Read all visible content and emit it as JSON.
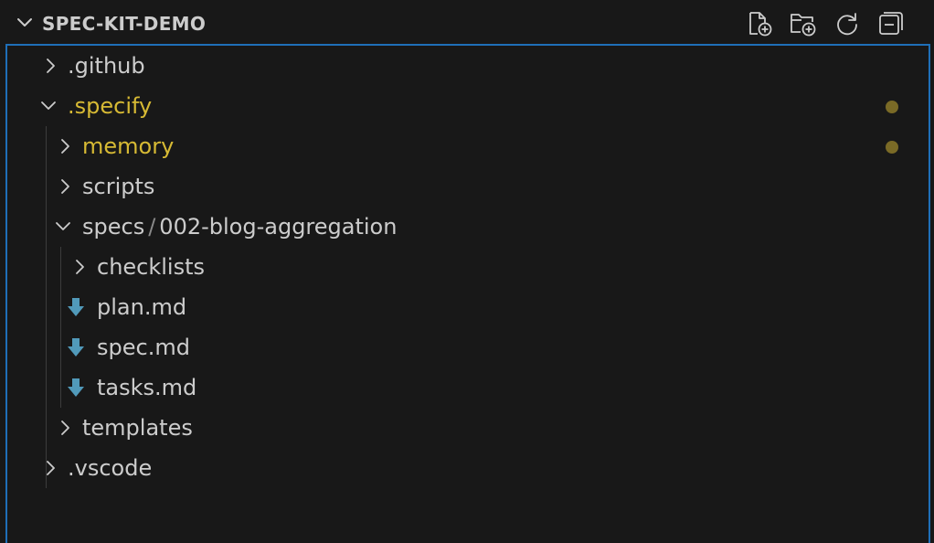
{
  "header": {
    "title": "SPEC-KIT-DEMO",
    "actions": [
      {
        "name": "new-file-icon",
        "label": "New File"
      },
      {
        "name": "new-folder-icon",
        "label": "New Folder"
      },
      {
        "name": "refresh-icon",
        "label": "Refresh Explorer"
      },
      {
        "name": "collapse-all-icon",
        "label": "Collapse Folders in Explorer"
      }
    ]
  },
  "tree": {
    "items": [
      {
        "label": ".github",
        "type": "folder",
        "expanded": false,
        "modified": false
      },
      {
        "label": ".specify",
        "type": "folder",
        "expanded": true,
        "modified": true
      },
      {
        "label": "memory",
        "type": "folder",
        "expanded": false,
        "modified": true
      },
      {
        "label": "scripts",
        "type": "folder",
        "expanded": false,
        "modified": false
      },
      {
        "label_parts": [
          "specs",
          "/",
          "002-blog-aggregation"
        ],
        "type": "folder",
        "expanded": true,
        "modified": false
      },
      {
        "label": "checklists",
        "type": "folder",
        "expanded": false,
        "modified": false
      },
      {
        "label": "plan.md",
        "type": "file",
        "icon": "markdown-arrow-icon"
      },
      {
        "label": "spec.md",
        "type": "file",
        "icon": "markdown-arrow-icon"
      },
      {
        "label": "tasks.md",
        "type": "file",
        "icon": "markdown-arrow-icon"
      },
      {
        "label": "templates",
        "type": "folder",
        "expanded": false,
        "modified": false
      },
      {
        "label": ".vscode",
        "type": "folder",
        "expanded": false,
        "modified": false
      }
    ]
  },
  "colors": {
    "background": "#181818",
    "text": "#cccccc",
    "modified_text": "#d7ba34",
    "modified_dot": "#7a6a26",
    "focus_border": "#1f6fb8",
    "markdown_icon": "#519aba"
  }
}
